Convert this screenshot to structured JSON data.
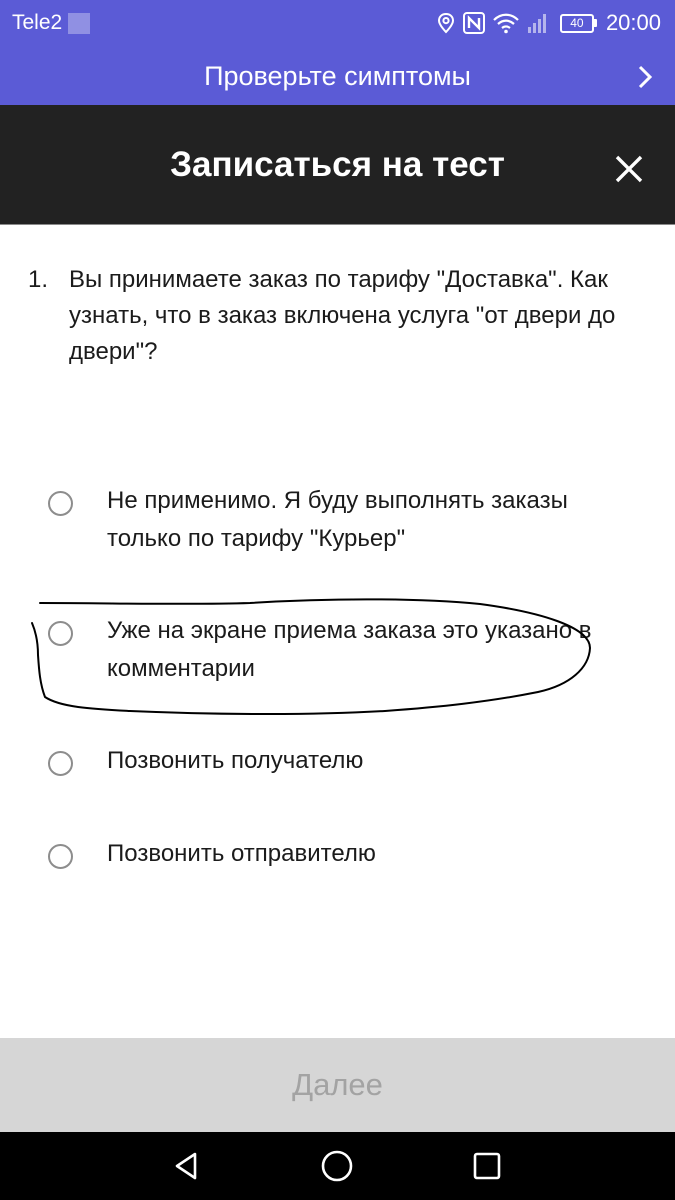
{
  "status_bar": {
    "carrier": "Tele2",
    "battery": "40",
    "time": "20:00",
    "icons": [
      "location-icon",
      "nfc-icon",
      "wifi-icon",
      "signal-icon",
      "battery-icon"
    ]
  },
  "banner": {
    "text": "Проверьте симптомы",
    "icon": "chevron-right-icon"
  },
  "header": {
    "title": "Записаться на тест",
    "close_icon": "close-icon"
  },
  "question": {
    "number": "1.",
    "text": "Вы принимаете заказ по тарифу  \"Доставка\". Как узнать, что в заказ включена услуга \"от двери до двери\"?"
  },
  "options": [
    {
      "label": "Не применимо. Я буду выполнять заказы только по тарифу \"Курьер\"",
      "selected": false
    },
    {
      "label": "Уже на экране приема заказа это указано в комментарии",
      "selected": false,
      "hand_circled": true
    },
    {
      "label": "Позвонить получателю",
      "selected": false
    },
    {
      "label": "Позвонить отправителю",
      "selected": false
    }
  ],
  "next_button": {
    "label": "Далее",
    "enabled": false
  },
  "nav_bar": {
    "icons": [
      "back-icon",
      "home-icon",
      "recents-icon"
    ]
  },
  "colors": {
    "accent": "#5B5BD6",
    "header_bg": "#222222",
    "disabled_button_bg": "#d6d6d6",
    "disabled_text": "#a3a3a3"
  }
}
